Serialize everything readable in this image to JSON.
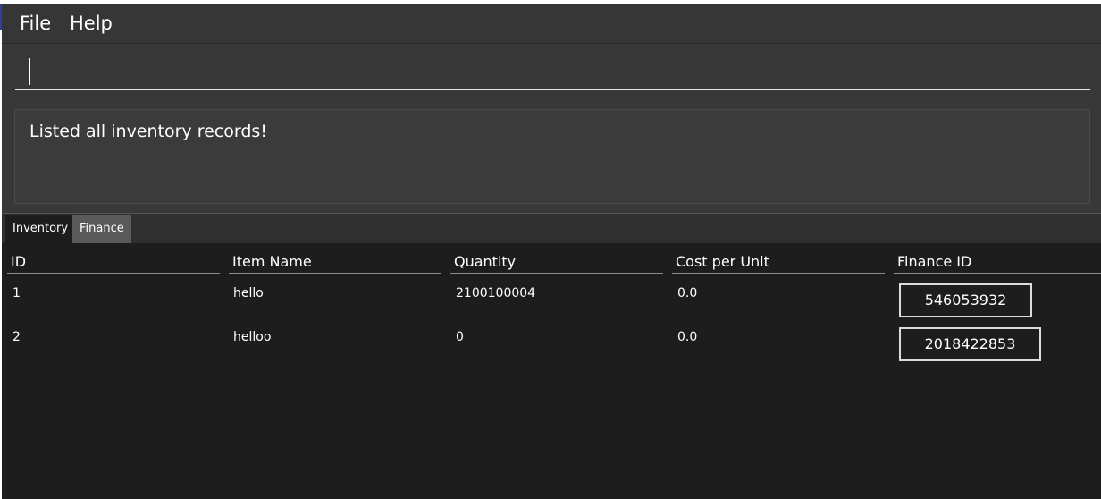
{
  "menu": {
    "file": "File",
    "help": "Help"
  },
  "command": {
    "value": "",
    "placeholder": ""
  },
  "result": {
    "message": "Listed all inventory records!"
  },
  "tabs": [
    {
      "label": "Inventory",
      "selected": true
    },
    {
      "label": "Finance",
      "selected": false
    }
  ],
  "table": {
    "columns": [
      "ID",
      "Item Name",
      "Quantity",
      "Cost per Unit",
      "Finance ID"
    ],
    "rows": [
      {
        "id": "1",
        "name": "hello",
        "quantity": "2100100004",
        "cost": "0.0",
        "finance_id": "546053932"
      },
      {
        "id": "2",
        "name": "helloo",
        "quantity": "0",
        "cost": "0.0",
        "finance_id": "2018422853"
      }
    ]
  },
  "colors": {
    "background": "#1d1d1d",
    "panel": "#383838",
    "accent": "#2e3f9e"
  }
}
